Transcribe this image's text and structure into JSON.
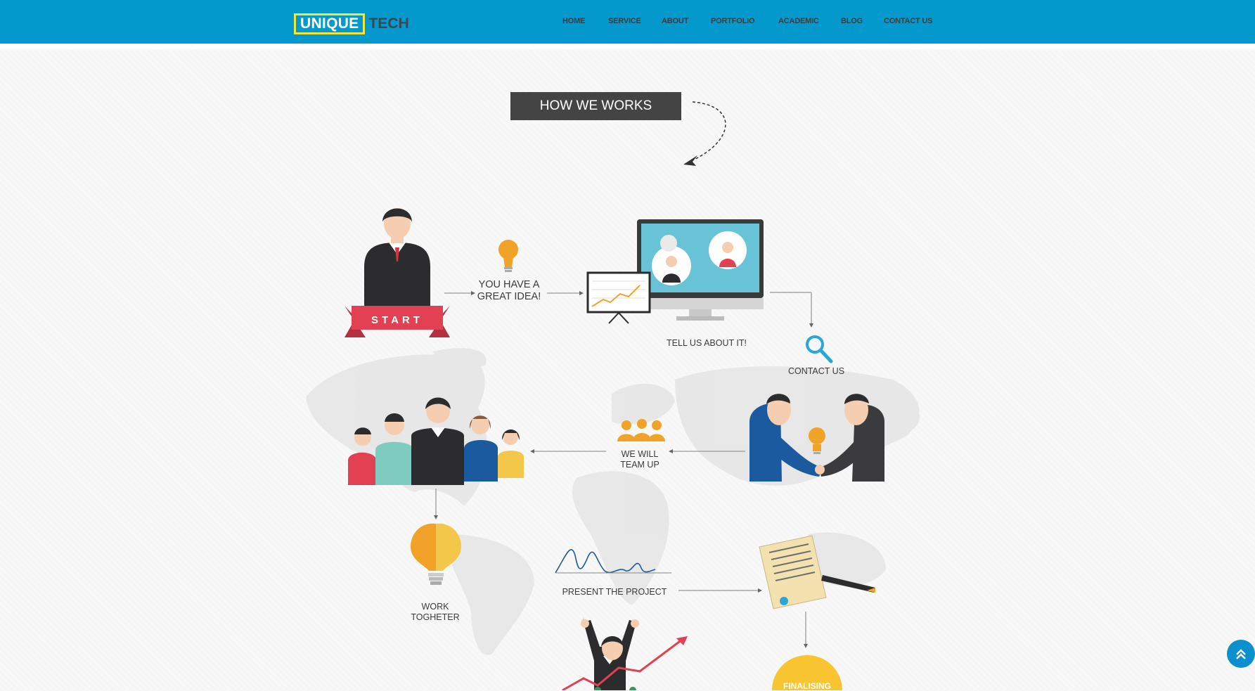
{
  "brand": {
    "logo_box": "UNIQUE",
    "logo_tail": "TECH"
  },
  "nav": [
    "HOME",
    "SERVICE",
    "ABOUT",
    "PORTFOLIO",
    "ACADEMIC",
    "BLOG",
    "CONTACT US"
  ],
  "section_title": "HOW WE WORKS",
  "steps": {
    "start": "START",
    "idea_line1": "YOU HAVE A",
    "idea_line2": "GREAT IDEA!",
    "tell": "TELL US ABOUT IT!",
    "contact": "CONTACT US",
    "team_line1": "WE WILL",
    "team_line2": "TEAM UP",
    "work_line1": "WORK",
    "work_line2": "TOGHETER",
    "present": "PRESENT THE PROJECT",
    "finalising": "FINALISING"
  },
  "colors": {
    "header": "#0499cd",
    "logo_border": "#f3e53a",
    "ribbon": "#e14152",
    "accent_orange": "#f0a229",
    "dark_suit": "#2c2c2e"
  }
}
